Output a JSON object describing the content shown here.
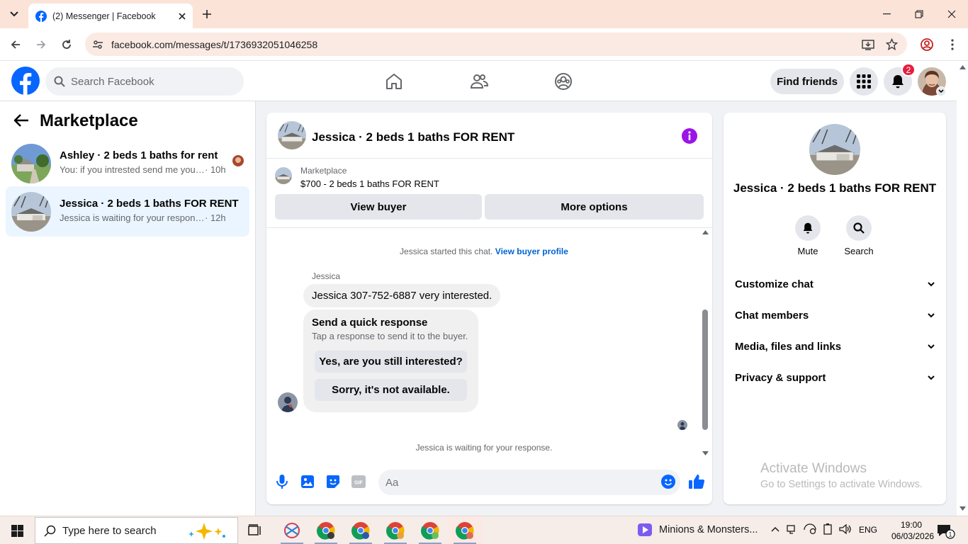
{
  "browser": {
    "tab_title": "(2) Messenger | Facebook",
    "url": "facebook.com/messages/t/1736932051046258"
  },
  "header": {
    "search_placeholder": "Search Facebook",
    "find_friends": "Find friends",
    "notification_count": "2",
    "brand_color": "#0866ff"
  },
  "left": {
    "title": "Marketplace",
    "conversations": [
      {
        "name": "Ashley · 2 beds 1 baths for rent",
        "preview": "You: if you intrested send me your…",
        "time": "· 10h"
      },
      {
        "name": "Jessica · 2 beds 1 baths FOR RENT",
        "preview": "Jessica is waiting for your response.",
        "time": " · 12h"
      }
    ]
  },
  "chat": {
    "title": "Jessica · 2 beds 1 baths FOR RENT",
    "marketplace_label": "Marketplace",
    "listing": "$700 - 2 beds 1 baths FOR RENT",
    "view_buyer": "View buyer",
    "more_options": "More options",
    "started_text": "Jessica started this chat. ",
    "view_buyer_profile": "View buyer profile",
    "sender_name": "Jessica",
    "message": "Jessica 307-752-6887 very interested.",
    "quick_title": "Send a quick response",
    "quick_sub": "Tap a response to send it to the buyer.",
    "quick_replies": [
      "Yes, are you still interested?",
      "Sorry, it's not available."
    ],
    "waiting": "Jessica is waiting for your response.",
    "input_placeholder": "Aa"
  },
  "right": {
    "title": "Jessica · 2 beds 1 baths FOR RENT",
    "mute": "Mute",
    "search": "Search",
    "sections": [
      "Customize chat",
      "Chat members",
      "Media, files and links",
      "Privacy & support"
    ],
    "watermark_title": "Activate Windows",
    "watermark_sub": "Go to Settings to activate Windows."
  },
  "taskbar": {
    "search_placeholder": "Type here to search",
    "media_title": "Minions & Monsters...",
    "lang": "ENG",
    "time": "19:00",
    "date": "06/03/2026",
    "notification_count": "1"
  }
}
